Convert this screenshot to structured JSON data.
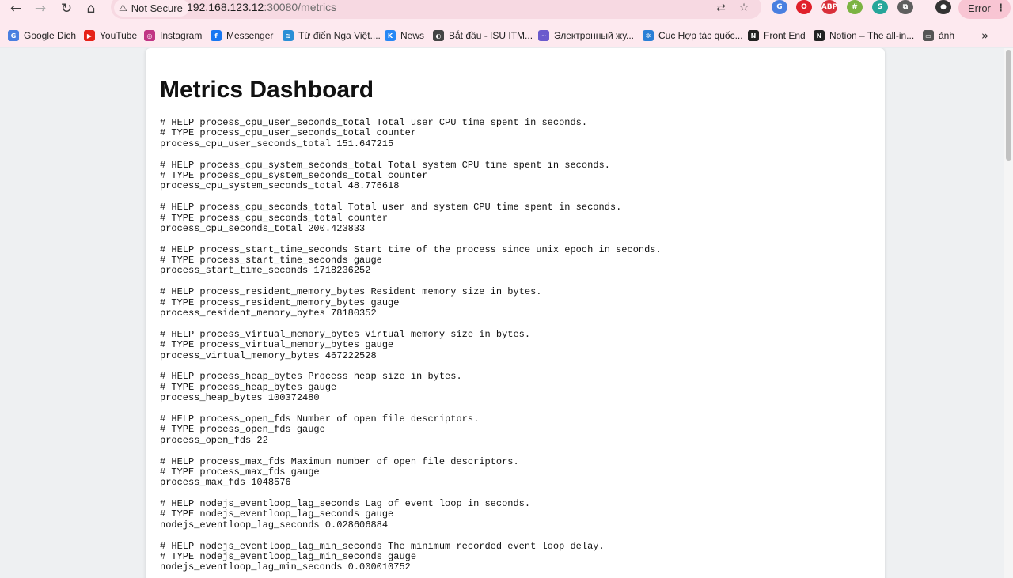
{
  "browser": {
    "security_label": "Not Secure",
    "url_host": "192.168.123.12",
    "url_path": ":30080/metrics",
    "error_label": "Error",
    "extensions": [
      {
        "icon": "google-translate-extension-icon",
        "label": "G",
        "color": "#4a7fe0"
      },
      {
        "icon": "opera-extension-icon",
        "label": "O",
        "color": "#e0202a"
      },
      {
        "icon": "adblock-plus-extension-icon",
        "label": "ABP",
        "color": "#d9303a"
      },
      {
        "icon": "hash-extension-icon",
        "label": "#",
        "color": "#7cb342"
      },
      {
        "icon": "shield-extension-icon",
        "label": "S",
        "color": "#26a69a"
      },
      {
        "icon": "puzzle-extensions-icon",
        "label": "⧉",
        "color": "#5f5f5f"
      }
    ]
  },
  "bookmarks": [
    {
      "label": "Google Dịch",
      "icon": "google-translate-icon",
      "glyph": "G",
      "color": "#4a7fe0"
    },
    {
      "label": "YouTube",
      "icon": "youtube-icon",
      "glyph": "▶",
      "color": "#e62117"
    },
    {
      "label": "Instagram",
      "icon": "instagram-icon",
      "glyph": "◎",
      "color": "#c13584"
    },
    {
      "label": "Messenger",
      "icon": "facebook-icon",
      "glyph": "f",
      "color": "#1877f2"
    },
    {
      "label": "Từ điển Nga Việt....",
      "icon": "dictionary-icon",
      "glyph": "≋",
      "color": "#2a8fd6"
    },
    {
      "label": "News",
      "icon": "vk-icon",
      "glyph": "K",
      "color": "#2787f5"
    },
    {
      "label": "Bắt đầu - ISU ITM...",
      "icon": "isu-icon",
      "glyph": "◐",
      "color": "#444444"
    },
    {
      "label": "Электронный жу...",
      "icon": "journal-icon",
      "glyph": "~",
      "color": "#6a5acd"
    },
    {
      "label": "Cục Hợp tác quốc...",
      "icon": "gear-network-icon",
      "glyph": "✲",
      "color": "#2a7fd6"
    },
    {
      "label": "Front End",
      "icon": "notion-icon",
      "glyph": "N",
      "color": "#222222"
    },
    {
      "label": "Notion – The all-in...",
      "icon": "notion-icon",
      "glyph": "N",
      "color": "#222222"
    },
    {
      "label": "ảnh",
      "icon": "folder-icon",
      "glyph": "▭",
      "color": "#555555"
    }
  ],
  "page": {
    "title": "Metrics Dashboard"
  },
  "metrics": [
    [
      "# HELP process_cpu_user_seconds_total Total user CPU time spent in seconds.",
      "# TYPE process_cpu_user_seconds_total counter",
      "process_cpu_user_seconds_total 151.647215"
    ],
    [
      "# HELP process_cpu_system_seconds_total Total system CPU time spent in seconds.",
      "# TYPE process_cpu_system_seconds_total counter",
      "process_cpu_system_seconds_total 48.776618"
    ],
    [
      "# HELP process_cpu_seconds_total Total user and system CPU time spent in seconds.",
      "# TYPE process_cpu_seconds_total counter",
      "process_cpu_seconds_total 200.423833"
    ],
    [
      "# HELP process_start_time_seconds Start time of the process since unix epoch in seconds.",
      "# TYPE process_start_time_seconds gauge",
      "process_start_time_seconds 1718236252"
    ],
    [
      "# HELP process_resident_memory_bytes Resident memory size in bytes.",
      "# TYPE process_resident_memory_bytes gauge",
      "process_resident_memory_bytes 78180352"
    ],
    [
      "# HELP process_virtual_memory_bytes Virtual memory size in bytes.",
      "# TYPE process_virtual_memory_bytes gauge",
      "process_virtual_memory_bytes 467222528"
    ],
    [
      "# HELP process_heap_bytes Process heap size in bytes.",
      "# TYPE process_heap_bytes gauge",
      "process_heap_bytes 100372480"
    ],
    [
      "# HELP process_open_fds Number of open file descriptors.",
      "# TYPE process_open_fds gauge",
      "process_open_fds 22"
    ],
    [
      "# HELP process_max_fds Maximum number of open file descriptors.",
      "# TYPE process_max_fds gauge",
      "process_max_fds 1048576"
    ],
    [
      "# HELP nodejs_eventloop_lag_seconds Lag of event loop in seconds.",
      "# TYPE nodejs_eventloop_lag_seconds gauge",
      "nodejs_eventloop_lag_seconds 0.028606884"
    ],
    [
      "# HELP nodejs_eventloop_lag_min_seconds The minimum recorded event loop delay.",
      "# TYPE nodejs_eventloop_lag_min_seconds gauge",
      "nodejs_eventloop_lag_min_seconds 0.000010752"
    ]
  ]
}
